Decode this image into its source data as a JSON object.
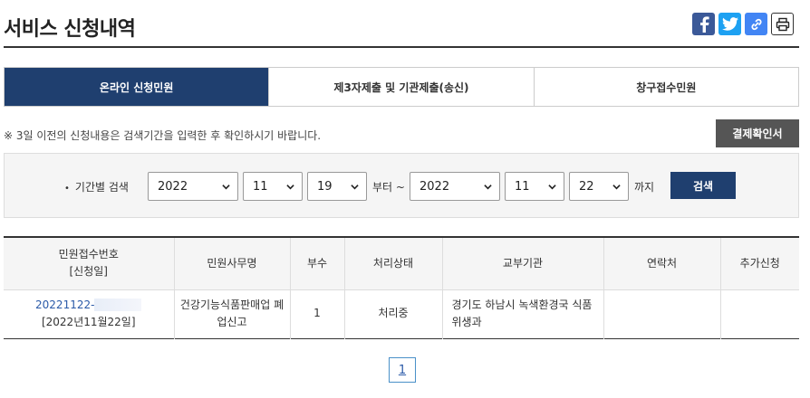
{
  "header": {
    "title": "서비스 신청내역"
  },
  "share": {
    "facebook_icon": "facebook-icon",
    "twitter_icon": "twitter-icon",
    "link_icon": "link-icon",
    "print_icon": "print-icon"
  },
  "tabs": [
    {
      "label": "온라인 신청민원",
      "active": true
    },
    {
      "label": "제3자제출 및 기관제출(송신)",
      "active": false
    },
    {
      "label": "창구접수민원",
      "active": false
    }
  ],
  "notice": "※ 3일 이전의 신청내용은 검색기간을 입력한 후 확인하시기 바랍니다.",
  "confirm_button": "결제확인서",
  "search": {
    "label": "기간별 검색",
    "from": {
      "year": "2022",
      "month": "11",
      "day": "19"
    },
    "from_suffix": "부터 ~",
    "to": {
      "year": "2022",
      "month": "11",
      "day": "22"
    },
    "to_suffix": "까지",
    "button": "검색"
  },
  "table": {
    "headers": {
      "receipt_no_line1": "민원접수번호",
      "receipt_no_line2": "[신청일]",
      "name": "민원사무명",
      "copies": "부수",
      "status": "처리상태",
      "agency": "교부기관",
      "contact": "연락처",
      "extra": "추가신청"
    },
    "rows": [
      {
        "receipt_no": "20221122-",
        "date": "[2022년11월22일]",
        "name_line1": "건강기능식품판매업 폐",
        "name_line2": "업신고",
        "copies": "1",
        "status": "처리중",
        "agency_line1": "경기도 하남시 녹색환경국 식품",
        "agency_line2": "위생과",
        "contact": "",
        "extra": ""
      }
    ]
  },
  "pagination": {
    "current": "1"
  },
  "colors": {
    "primary": "#1f3f6f",
    "facebook": "#3b5998",
    "twitter": "#1da1f2",
    "link": "#4285f4"
  }
}
